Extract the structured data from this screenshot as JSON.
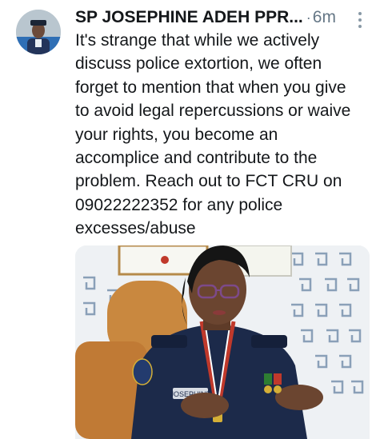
{
  "tweet": {
    "author_name": "SP JOSEPHINE ADEH PPR...",
    "separator": "·",
    "timestamp": "6m",
    "more_icon": "vertical-ellipsis-icon",
    "text": "It's strange that while we actively\ndiscuss police extortion, we often\nforget to mention that when you give\nto avoid legal repercussions or waive\nyour rights, you become an\naccomplice and contribute to the\nproblem. Reach out to FCT CRU on\n09022222352 for any police\nexcesses/abuse",
    "media_badge_text": "JOSEPHINE"
  },
  "colors": {
    "text": "#14171a",
    "secondary": "#657786",
    "uniform": "#1c2a4a"
  }
}
